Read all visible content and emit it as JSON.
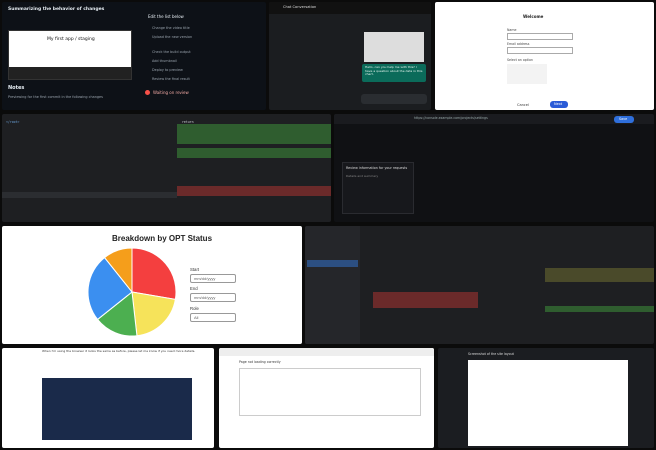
{
  "tile1": {
    "title": "Summarizing the behavior of changes",
    "video_title": "My first app / staging",
    "notes_label": "Notes",
    "notes_text": "Previewing for the first commit in the following changes",
    "checklist_title": "Edit the list below",
    "items": [
      "Change the video title",
      "Upload the new version",
      "Check the build output",
      "Add thumbnail",
      "Deploy to preview",
      "Review the final result"
    ],
    "warning": "Waiting on review"
  },
  "tile2": {
    "header": "Chat Conversation",
    "message": "Hello, can you help me with this? I have a question about the data in this chart."
  },
  "tile3": {
    "heading": "Welcome",
    "field1": "Name",
    "field2": "Email address",
    "radio_label": "Select an option",
    "cancel": "Cancel",
    "next": "Next"
  },
  "tile4": {},
  "tile5": {
    "url": "https://console.example.com/projects/settings",
    "button": "Save",
    "card_title": "Review information for your requests",
    "card_text": "Details and summary"
  },
  "chart": {
    "title": "Breakdown by OPT Status",
    "start_label": "Start",
    "end_label": "End",
    "date_placeholder": "mm/dd/yyyy",
    "role_label": "Role",
    "role_value": "All"
  },
  "chart_data": {
    "type": "pie",
    "title": "Breakdown by OPT Status",
    "slices": [
      {
        "value": 31,
        "color": "#f43f3f"
      },
      {
        "value": 23,
        "color": "#f6e35a"
      },
      {
        "value": 18,
        "color": "#4caf50"
      },
      {
        "value": 28,
        "color": "#3b8ff0"
      },
      {
        "value": 12,
        "color": "#f59e1b"
      }
    ]
  },
  "tile7": {},
  "tile8": {
    "text": "When I'm using the browser it looks the same as before, please let me know if you need more details."
  },
  "tile9": {
    "header": "Page not loading correctly"
  },
  "tile10": {
    "title": "Screenshot of the site layout"
  }
}
